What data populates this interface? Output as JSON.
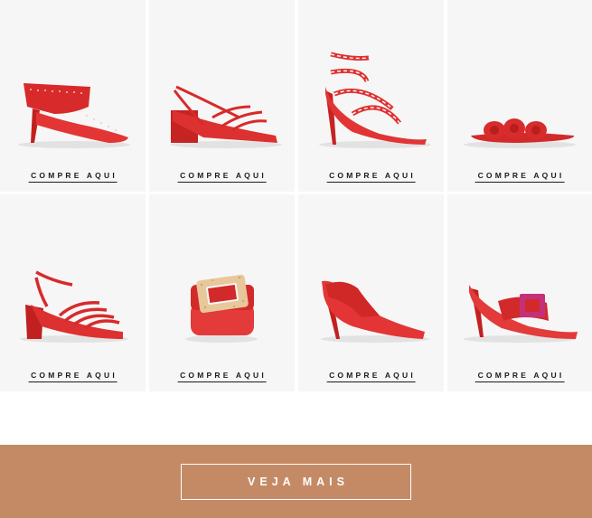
{
  "products": [
    {
      "name": "red-studded-mule",
      "cta": "COMPRE AQUI"
    },
    {
      "name": "red-strappy-block-heel",
      "cta": "COMPRE AQUI"
    },
    {
      "name": "red-white-strappy-stiletto",
      "cta": "COMPRE AQUI"
    },
    {
      "name": "red-bubble-flat-slide",
      "cta": "COMPRE AQUI"
    },
    {
      "name": "red-multi-strap-block-heel",
      "cta": "COMPRE AQUI"
    },
    {
      "name": "red-wide-belt-cork-buckle",
      "cta": "COMPRE AQUI"
    },
    {
      "name": "red-elastic-pointed-pump",
      "cta": "COMPRE AQUI"
    },
    {
      "name": "red-pink-buckle-mule",
      "cta": "COMPRE AQUI"
    }
  ],
  "banner": {
    "cta": "VEJA MAIS"
  },
  "colors": {
    "shoe_red": "#d92b2b",
    "card_bg": "#f6f6f6",
    "banner": "#c48a66",
    "text": "#1c1c1c"
  }
}
